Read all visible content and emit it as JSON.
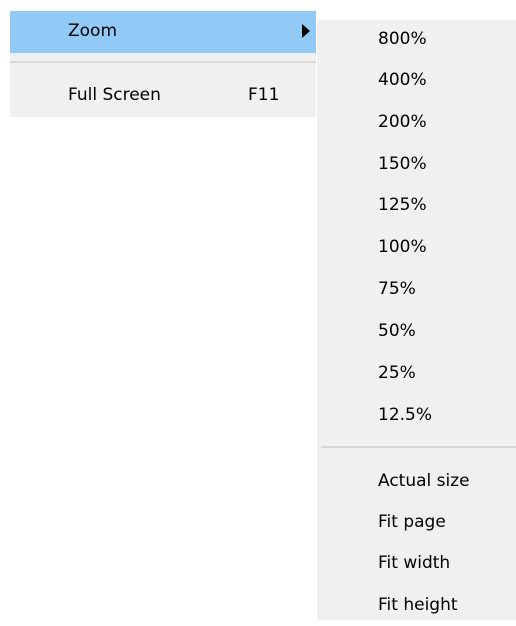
{
  "menu": {
    "items": [
      {
        "label": "Zoom",
        "has_submenu": true,
        "highlighted": true
      },
      {
        "label": "Full Screen",
        "shortcut": "F11"
      }
    ]
  },
  "zoom_submenu": {
    "percent_options": [
      "800%",
      "400%",
      "200%",
      "150%",
      "125%",
      "100%",
      "75%",
      "50%",
      "25%",
      "12.5%"
    ],
    "fit_options": [
      "Actual size",
      "Fit page",
      "Fit width",
      "Fit height"
    ]
  },
  "colors": {
    "menu_background": "#f0f0f0",
    "highlight": "#91c9f7",
    "separator": "#d7d7d7",
    "text": "#000000"
  }
}
